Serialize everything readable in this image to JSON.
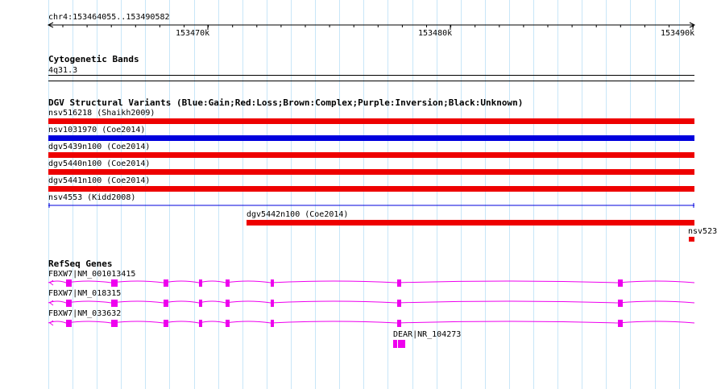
{
  "ruler": {
    "position": "chr4:153464055..153490582",
    "ticks": [
      "153470k",
      "153480k",
      "153490k"
    ]
  },
  "cytoband": {
    "title": "Cytogenetic Bands",
    "band": "4q31.3"
  },
  "dgv": {
    "title": "DGV Structural Variants (Blue:Gain;Red:Loss;Brown:Complex;Purple:Inversion;Black:Unknown)",
    "variants": [
      {
        "label": "nsv516218 (Shaikh2009)",
        "color": "#ee0000"
      },
      {
        "label": "nsv1031970 (Coe2014)",
        "color": "#0000dd"
      },
      {
        "label": "dgv5439n100 (Coe2014)",
        "color": "#ee0000"
      },
      {
        "label": "dgv5440n100 (Coe2014)",
        "color": "#ee0000"
      },
      {
        "label": "dgv5441n100 (Coe2014)",
        "color": "#ee0000"
      },
      {
        "label": "nsv4553 (Kidd2008)",
        "color": "#0000dd"
      },
      {
        "label": "dgv5442n100 (Coe2014)",
        "color": "#ee0000"
      },
      {
        "label": "nsv523",
        "color": "#ee0000"
      }
    ]
  },
  "refseq": {
    "title": "RefSeq Genes",
    "color": "#ee00ee",
    "genes": [
      {
        "label": "FBXW7|NM_001013415"
      },
      {
        "label": "FBXW7|NM_018315"
      },
      {
        "label": "FBXW7|NM_033632"
      },
      {
        "label": "DEAR|NR_104273"
      }
    ]
  }
}
